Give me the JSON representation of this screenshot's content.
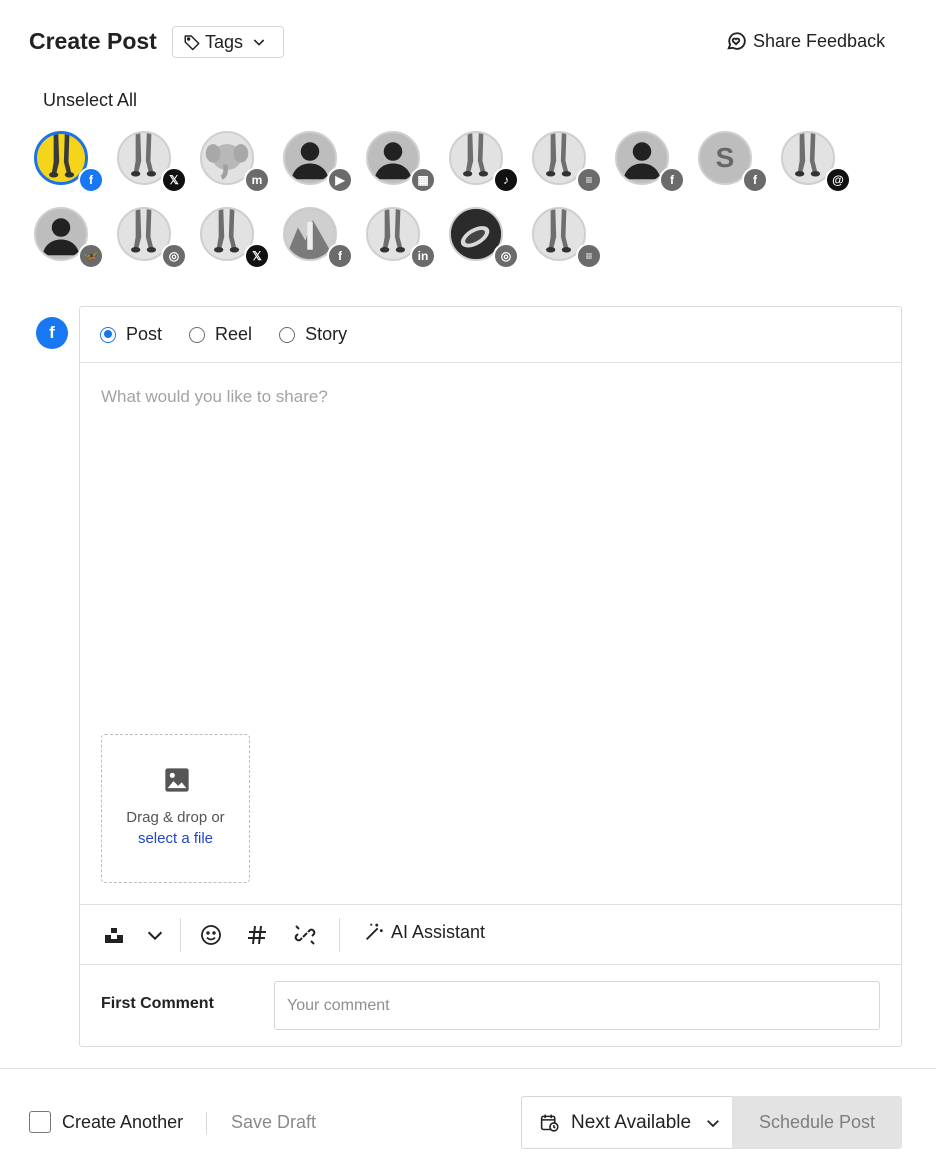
{
  "header": {
    "title": "Create Post",
    "tags_label": "Tags",
    "feedback_label": "Share Feedback"
  },
  "accounts": {
    "unselect_all_label": "Unselect All",
    "items": [
      {
        "avatar": "yellow-legs",
        "network": "facebook",
        "selected": true
      },
      {
        "avatar": "legs-grey",
        "network": "x"
      },
      {
        "avatar": "elephant",
        "network": "mastodon"
      },
      {
        "avatar": "person",
        "network": "youtube"
      },
      {
        "avatar": "person",
        "network": "google-business"
      },
      {
        "avatar": "legs-grey",
        "network": "tiktok"
      },
      {
        "avatar": "legs-grey",
        "network": "blog"
      },
      {
        "avatar": "person",
        "network": "facebook"
      },
      {
        "avatar": "letter",
        "letter": "S",
        "network": "facebook"
      },
      {
        "avatar": "legs-grey",
        "network": "threads"
      },
      {
        "avatar": "person",
        "network": "bluesky"
      },
      {
        "avatar": "legs-grey",
        "network": "instagram"
      },
      {
        "avatar": "legs-grey",
        "network": "x"
      },
      {
        "avatar": "photo",
        "network": "facebook"
      },
      {
        "avatar": "legs-grey",
        "network": "linkedin"
      },
      {
        "avatar": "dark-photo",
        "network": "instagram"
      },
      {
        "avatar": "legs-grey",
        "network": "blog"
      }
    ]
  },
  "editor": {
    "post_types": [
      {
        "label": "Post",
        "checked": true
      },
      {
        "label": "Reel",
        "checked": false
      },
      {
        "label": "Story",
        "checked": false
      }
    ],
    "compose_placeholder": "What would you like to share?",
    "dropzone_text": "Drag & drop or",
    "dropzone_link": "select a file",
    "ai_assistant_label": "AI Assistant",
    "first_comment_label": "First Comment",
    "first_comment_placeholder": "Your comment"
  },
  "footer": {
    "create_another_label": "Create Another",
    "save_draft_label": "Save Draft",
    "next_available_label": "Next Available",
    "schedule_label": "Schedule Post"
  },
  "colors": {
    "accent": "#1a74e8",
    "facebook": "#1877f2",
    "link": "#2047c7",
    "disabled_bg": "#e3e3e3"
  }
}
